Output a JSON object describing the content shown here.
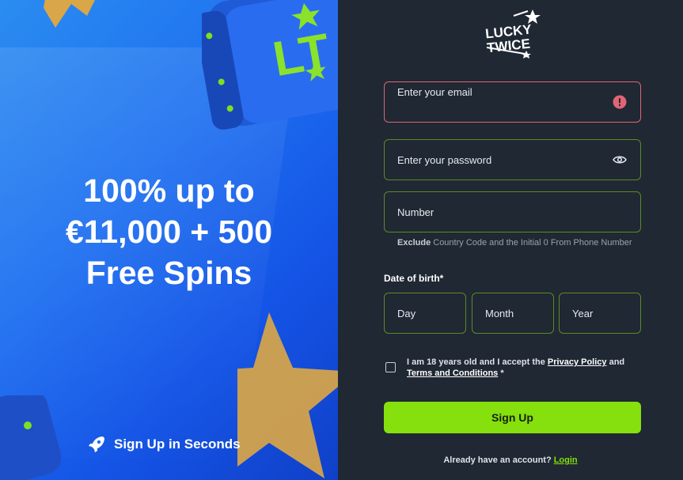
{
  "promo": {
    "headline_line1": "100% up to",
    "headline_line2": "€11,000 + 500",
    "headline_line3": "Free Spins",
    "tagline": "Sign Up in Seconds",
    "dice_logo_text": "LT"
  },
  "brand": {
    "logo_line1": "LUCKY",
    "logo_line2": "TWICE",
    "accent_color": "#85e00e",
    "error_color": "#e06476"
  },
  "form": {
    "email_label": "Enter your email",
    "password_label": "Enter your password",
    "number_label": "Number",
    "number_hint_bold": "Exclude",
    "number_hint_rest": " Country Code and the Initial 0 From Phone Number",
    "dob_label": "Date of birth*",
    "dob_day": "Day",
    "dob_month": "Month",
    "dob_year": "Year",
    "consent_prefix": "I am 18 years old and I accept the ",
    "privacy_link": "Privacy Policy",
    "consent_and": " and ",
    "terms_link": "Terms and Conditions",
    "consent_suffix": " *",
    "signup_button": "Sign Up",
    "login_prompt": "Already have an account?",
    "login_link": "Login"
  }
}
